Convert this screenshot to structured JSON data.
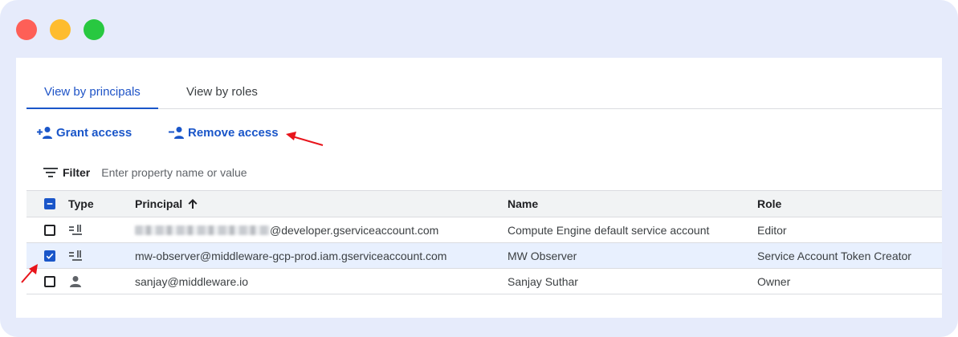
{
  "window": {
    "controls": [
      "close",
      "minimize",
      "maximize"
    ],
    "colors": {
      "close": "#fe5f57",
      "minimize": "#febc2e",
      "maximize": "#28c840"
    }
  },
  "tabs": [
    {
      "label": "View by principals",
      "active": true
    },
    {
      "label": "View by roles",
      "active": false
    }
  ],
  "actions": {
    "grant": {
      "label": "Grant access",
      "icon": "person-add-icon"
    },
    "remove": {
      "label": "Remove access",
      "icon": "person-remove-icon"
    }
  },
  "filter": {
    "label": "Filter",
    "placeholder": "Enter property name or value",
    "icon": "filter-list-icon"
  },
  "table": {
    "headers": {
      "type": "Type",
      "principal": "Principal",
      "name": "Name",
      "role": "Role"
    },
    "sort": {
      "column": "Principal",
      "direction": "ascending"
    },
    "header_checkbox": "indeterminate",
    "rows": [
      {
        "checked": false,
        "type_icon": "service-account-icon",
        "principal_suffix": "@developer.gserviceaccount.com",
        "principal_redacted": true,
        "name": "Compute Engine default service account",
        "role": "Editor"
      },
      {
        "checked": true,
        "type_icon": "service-account-icon",
        "principal": "mw-observer@middleware-gcp-prod.iam.gserviceaccount.com",
        "name": "MW Observer",
        "role": "Service Account Token Creator"
      },
      {
        "checked": false,
        "type_icon": "person-icon",
        "principal": "sanjay@middleware.io",
        "name": "Sanjay Suthar",
        "role": "Owner"
      }
    ]
  },
  "colors": {
    "accent": "#1a56c9",
    "frame": "#e6ebfb",
    "selected_row": "#e8f0fe",
    "annotation_arrow": "#e8141b"
  }
}
